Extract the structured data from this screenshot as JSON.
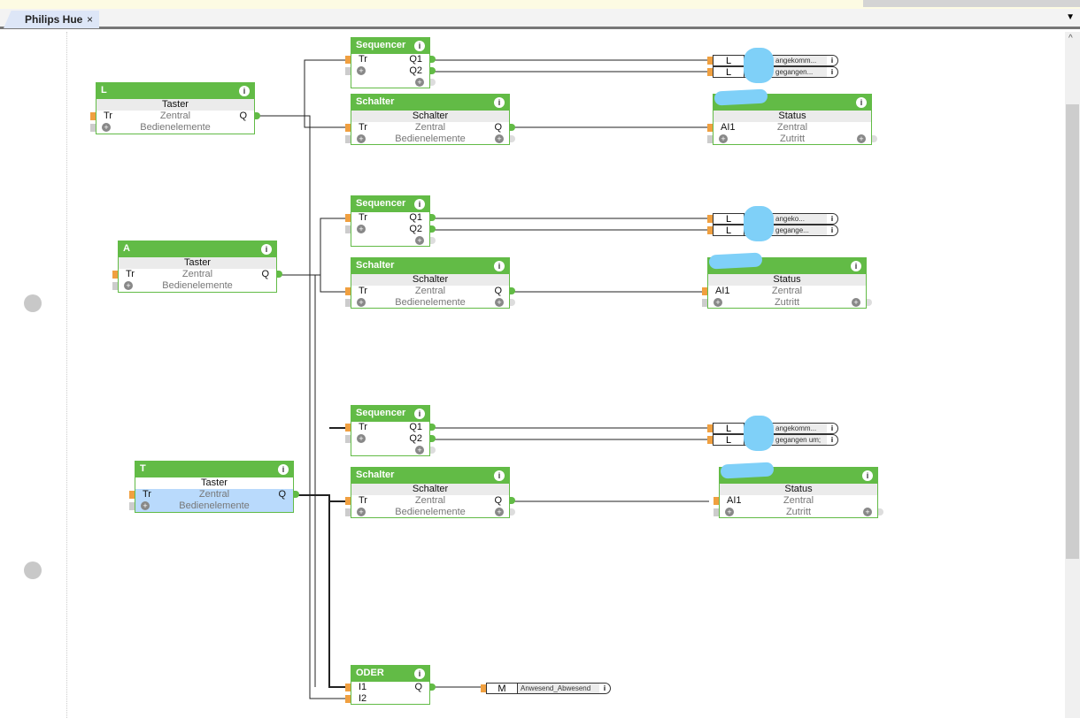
{
  "tab": {
    "title": "Philips Hue",
    "close": "×"
  },
  "blocks": {
    "L": {
      "title": "L",
      "type": "Taster",
      "in": "Tr",
      "mid": "Zentral",
      "out": "Q",
      "sub2": "Bedienelemente"
    },
    "A": {
      "title": "A",
      "type": "Taster",
      "in": "Tr",
      "mid": "Zentral",
      "out": "Q",
      "sub2": "Bedienelemente"
    },
    "T": {
      "title": "T",
      "type": "Taster",
      "in": "Tr",
      "mid": "Zentral",
      "out": "Q",
      "sub2": "Bedienelemente"
    },
    "seq": {
      "title": "Sequencer",
      "in": "Tr",
      "q1": "Q1",
      "q2": "Q2"
    },
    "sch": {
      "title": "Schalter",
      "type": "Schalter",
      "in": "Tr",
      "mid": "Zentral",
      "out": "Q",
      "sub2": "Bedienelemente"
    },
    "status": {
      "type": "Status",
      "in": "AI1",
      "mid": "Zentral",
      "sub2": "Zutritt"
    },
    "oder": {
      "title": "ODER",
      "i1": "I1",
      "i2": "I2",
      "out": "Q"
    }
  },
  "outputs": {
    "g1": [
      {
        "k": "L",
        "t": "angekomm..."
      },
      {
        "k": "L",
        "t": "gegangen..."
      }
    ],
    "g2": [
      {
        "k": "L",
        "t": "angeko..."
      },
      {
        "k": "L",
        "t": "gegange..."
      }
    ],
    "g3": [
      {
        "k": "L",
        "t": "angekomm..."
      },
      {
        "k": "L",
        "t": "gegangen um;"
      }
    ],
    "m": {
      "k": "M",
      "t": "Anwesend_Abwesend"
    }
  },
  "info_glyph": "i",
  "colors": {
    "block": "#62bb46",
    "selected": "#b9dafc",
    "redaction": "#7fd0f8"
  }
}
